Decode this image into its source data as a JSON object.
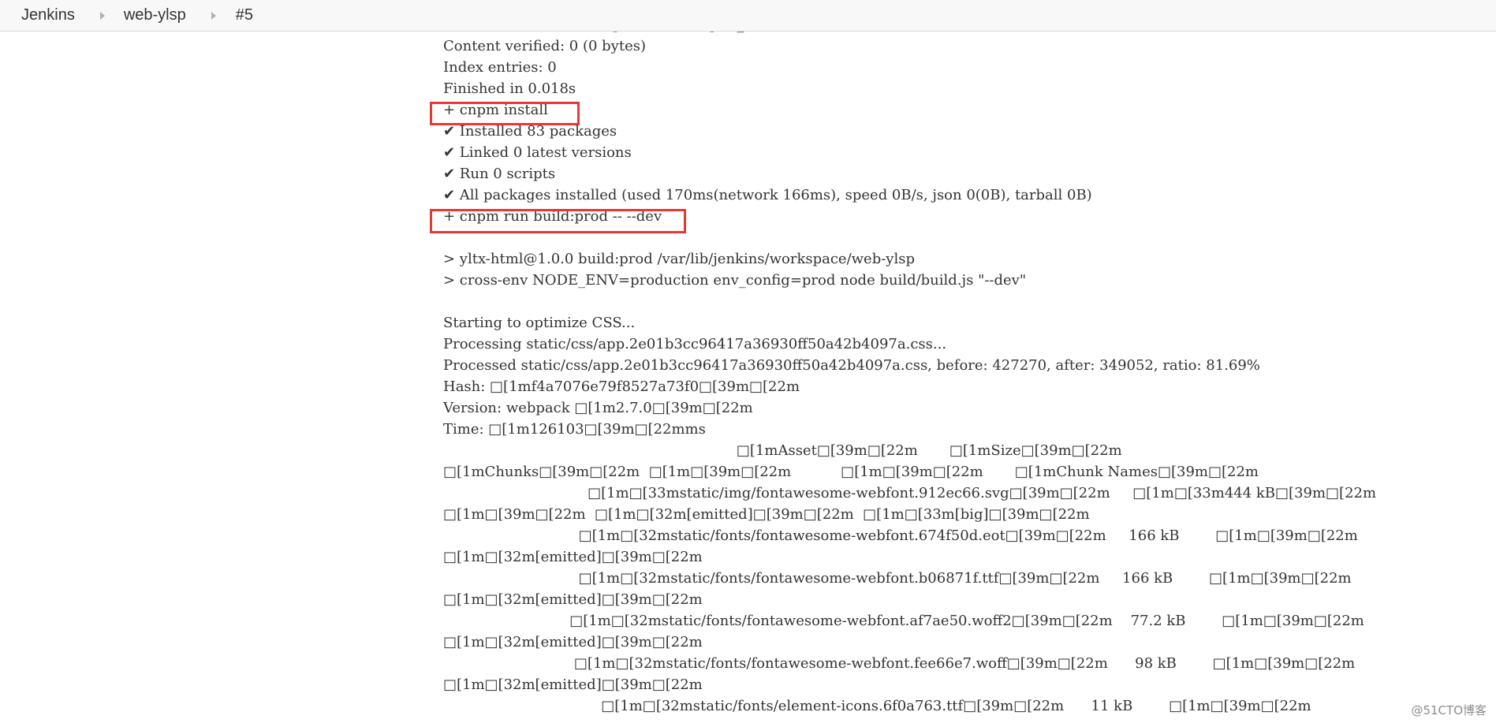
{
  "breadcrumb": {
    "items": [
      "Jenkins",
      "web-ylsp",
      "#5"
    ]
  },
  "console": {
    "lines": [
      "Cache verified and compressed (~/.npm/_cacache):",
      "Content verified: 0 (0 bytes)",
      "Index entries: 0",
      "Finished in 0.018s",
      "+ cnpm install",
      "✔ Installed 83 packages",
      "✔ Linked 0 latest versions",
      "✔ Run 0 scripts",
      "✔ All packages installed (used 170ms(network 166ms), speed 0B/s, json 0(0B), tarball 0B)",
      "+ cnpm run build:prod -- --dev",
      "",
      "> yltx-html@1.0.0 build:prod /var/lib/jenkins/workspace/web-ylsp",
      "> cross-env NODE_ENV=production env_config=prod node build/build.js \"--dev\"",
      "",
      "Starting to optimize CSS...",
      "Processing static/css/app.2e01b3cc96417a36930ff50a42b4097a.css...",
      "Processed static/css/app.2e01b3cc96417a36930ff50a42b4097a.css, before: 427270, after: 349052, ratio: 81.69%",
      "Hash: \u001b[1mf4a7076e79f8527a73f0\u001b[39m\u001b[22m",
      "Version: webpack \u001b[1m2.7.0\u001b[39m\u001b[22m",
      "Time: \u001b[1m126103\u001b[39m\u001b[22mms",
      "                                                                 \u001b[1mAsset\u001b[39m\u001b[22m       \u001b[1mSize\u001b[39m\u001b[22m",
      "\u001b[1mChunks\u001b[39m\u001b[22m  \u001b[1m\u001b[39m\u001b[22m           \u001b[1m\u001b[39m\u001b[22m       \u001b[1mChunk Names\u001b[39m\u001b[22m",
      "                                \u001b[1m\u001b[33mstatic/img/fontawesome-webfont.912ec66.svg\u001b[39m\u001b[22m     \u001b[1m\u001b[33m444 kB\u001b[39m\u001b[22m",
      "\u001b[1m\u001b[39m\u001b[22m  \u001b[1m\u001b[32m[emitted]\u001b[39m\u001b[22m  \u001b[1m\u001b[33m[big]\u001b[39m\u001b[22m",
      "                              \u001b[1m\u001b[32mstatic/fonts/fontawesome-webfont.674f50d.eot\u001b[39m\u001b[22m     166 kB        \u001b[1m\u001b[39m\u001b[22m",
      "\u001b[1m\u001b[32m[emitted]\u001b[39m\u001b[22m",
      "                              \u001b[1m\u001b[32mstatic/fonts/fontawesome-webfont.b06871f.ttf\u001b[39m\u001b[22m     166 kB        \u001b[1m\u001b[39m\u001b[22m",
      "\u001b[1m\u001b[32m[emitted]\u001b[39m\u001b[22m",
      "                            \u001b[1m\u001b[32mstatic/fonts/fontawesome-webfont.af7ae50.woff2\u001b[39m\u001b[22m    77.2 kB        \u001b[1m\u001b[39m\u001b[22m",
      "\u001b[1m\u001b[32m[emitted]\u001b[39m\u001b[22m",
      "                             \u001b[1m\u001b[32mstatic/fonts/fontawesome-webfont.fee66e7.woff\u001b[39m\u001b[22m      98 kB        \u001b[1m\u001b[39m\u001b[22m",
      "\u001b[1m\u001b[32m[emitted]\u001b[39m\u001b[22m",
      "                                   \u001b[1m\u001b[32mstatic/fonts/element-icons.6f0a763.ttf\u001b[39m\u001b[22m      11 kB        \u001b[1m\u001b[39m\u001b[22m"
    ],
    "highlight_color": "#e53935"
  },
  "watermark": "@51CTO博客"
}
